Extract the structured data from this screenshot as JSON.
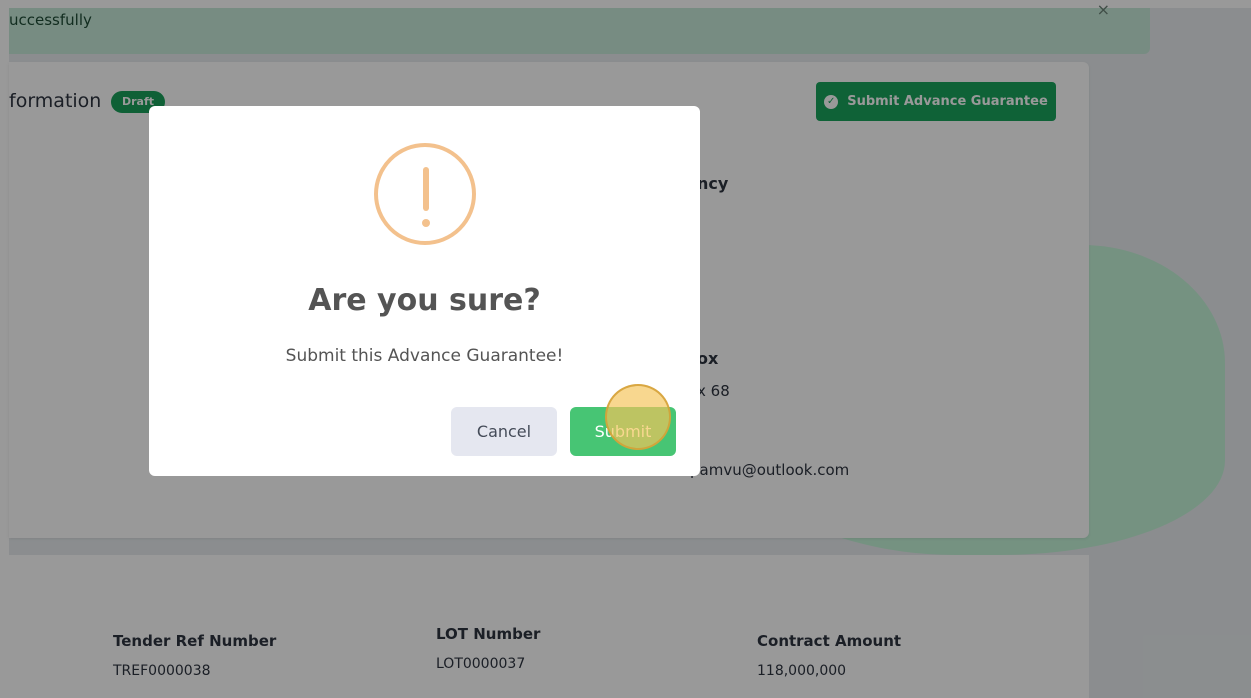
{
  "alert": {
    "text": "uccessfully",
    "close_icon": "close-icon"
  },
  "card": {
    "title": "formation",
    "badge": "Draft",
    "submit_button_label": "Submit Advance Guarantee",
    "submit_button_icon": "check-circle-icon"
  },
  "fields": {
    "agency_label_fragment": "ncy",
    "box_label_fragment": "ox",
    "box_value_fragment": "x 68",
    "email_fragment": "pamvu@outlook.com"
  },
  "details": {
    "tender_ref_label": "Tender Ref Number",
    "tender_ref_value": "TREF0000038",
    "lot_label": "LOT Number",
    "lot_value": "LOT0000037",
    "contract_amount_label": "Contract Amount",
    "contract_amount_value": "118,000,000"
  },
  "modal": {
    "icon": "warning-icon",
    "title": "Are you sure?",
    "text": "Submit this Advance Guarantee!",
    "cancel_label": "Cancel",
    "submit_label": "Submit"
  },
  "colors": {
    "primary": "#1aa35d",
    "modal_submit": "#47c574",
    "warning": "#f3c18d",
    "alert_bg": "#c7ead9"
  }
}
